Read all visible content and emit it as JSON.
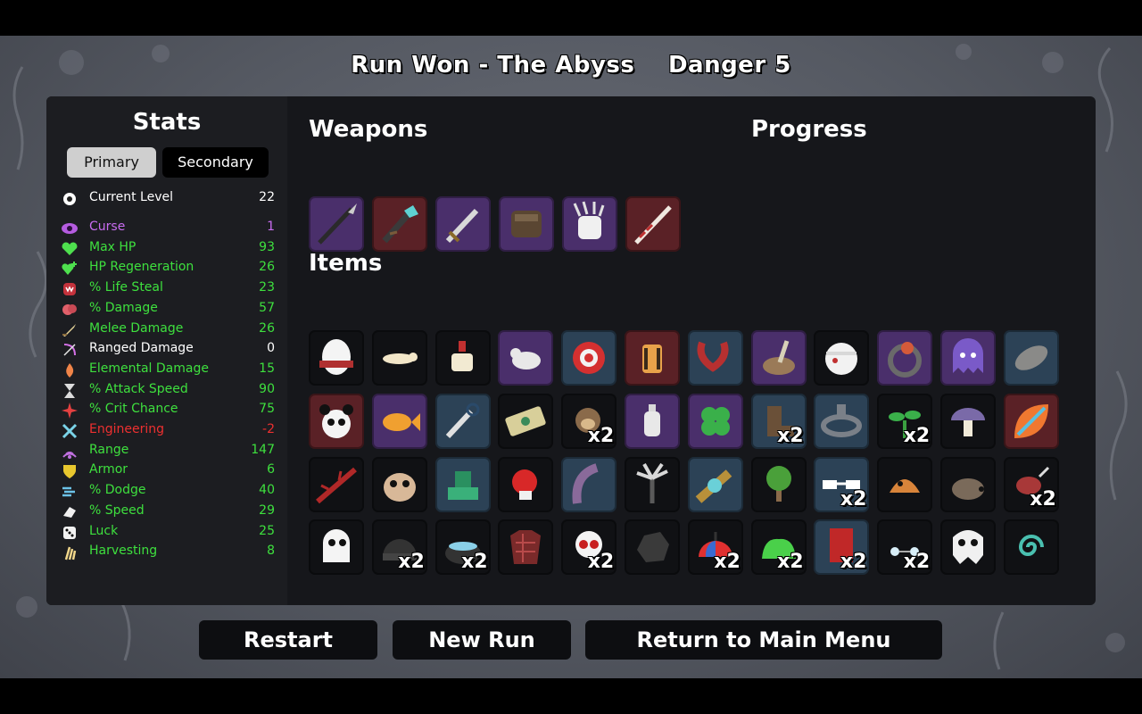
{
  "header": {
    "run_result": "Run Won - The Abyss",
    "danger": "Danger 5"
  },
  "stats": {
    "title": "Stats",
    "tabs": {
      "primary": "Primary",
      "secondary": "Secondary"
    },
    "rows": [
      {
        "icon": "level-icon",
        "label": "Current Level",
        "value": "22",
        "color": "#ffffff"
      },
      {
        "icon": "curse-icon",
        "label": "Curse",
        "value": "1",
        "color": "#c86cf0"
      },
      {
        "icon": "heart-icon",
        "label": "Max HP",
        "value": "93",
        "color": "#3ee03e"
      },
      {
        "icon": "hp-regen-icon",
        "label": "HP Regeneration",
        "value": "26",
        "color": "#3ee03e"
      },
      {
        "icon": "life-steal-icon",
        "label": "% Life Steal",
        "value": "23",
        "color": "#3ee03e"
      },
      {
        "icon": "damage-icon",
        "label": "% Damage",
        "value": "57",
        "color": "#3ee03e"
      },
      {
        "icon": "melee-icon",
        "label": "Melee Damage",
        "value": "26",
        "color": "#3ee03e"
      },
      {
        "icon": "ranged-icon",
        "label": "Ranged Damage",
        "value": "0",
        "color": "#ffffff"
      },
      {
        "icon": "elemental-icon",
        "label": "Elemental Damage",
        "value": "15",
        "color": "#3ee03e"
      },
      {
        "icon": "hourglass-icon",
        "label": "% Attack Speed",
        "value": "90",
        "color": "#3ee03e"
      },
      {
        "icon": "crit-icon",
        "label": "% Crit Chance",
        "value": "75",
        "color": "#3ee03e"
      },
      {
        "icon": "engineering-icon",
        "label": "Engineering",
        "value": "-2",
        "color": "#ee3030"
      },
      {
        "icon": "range-icon",
        "label": "Range",
        "value": "147",
        "color": "#3ee03e"
      },
      {
        "icon": "armor-icon",
        "label": "Armor",
        "value": "6",
        "color": "#3ee03e"
      },
      {
        "icon": "dodge-icon",
        "label": "% Dodge",
        "value": "40",
        "color": "#3ee03e"
      },
      {
        "icon": "speed-icon",
        "label": "% Speed",
        "value": "29",
        "color": "#3ee03e"
      },
      {
        "icon": "luck-icon",
        "label": "Luck",
        "value": "25",
        "color": "#3ee03e"
      },
      {
        "icon": "harvesting-icon",
        "label": "Harvesting",
        "value": "8",
        "color": "#3ee03e"
      }
    ]
  },
  "weapons": {
    "title": "Weapons",
    "slots": [
      {
        "icon": "spear-icon",
        "tier": 2
      },
      {
        "icon": "tentacle-blade-icon",
        "tier": 3
      },
      {
        "icon": "sword-icon",
        "tier": 2
      },
      {
        "icon": "power-fist-icon",
        "tier": 2
      },
      {
        "icon": "claw-glove-icon",
        "tier": 2
      },
      {
        "icon": "lance-icon",
        "tier": 3
      }
    ]
  },
  "progress": {
    "title": "Progress"
  },
  "items": {
    "title": "Items",
    "slots": [
      {
        "icon": "egg-icon",
        "tier": 0,
        "count": ""
      },
      {
        "icon": "ferret-icon",
        "tier": 0,
        "count": ""
      },
      {
        "icon": "coffee-cup-icon",
        "tier": 0,
        "count": ""
      },
      {
        "icon": "rat-icon",
        "tier": 2,
        "count": ""
      },
      {
        "icon": "target-ring-icon",
        "tier": 1,
        "count": ""
      },
      {
        "icon": "lantern-icon",
        "tier": 3,
        "count": ""
      },
      {
        "icon": "horn-creature-icon",
        "tier": 1,
        "count": ""
      },
      {
        "icon": "mortar-pestle-icon",
        "tier": 2,
        "count": ""
      },
      {
        "icon": "bandaged-head-icon",
        "tier": 0,
        "count": ""
      },
      {
        "icon": "eye-ring-icon",
        "tier": 2,
        "count": ""
      },
      {
        "icon": "ghost-blob-icon",
        "tier": 2,
        "count": ""
      },
      {
        "icon": "cocoon-icon",
        "tier": 1,
        "count": ""
      },
      {
        "icon": "panda-icon",
        "tier": 3,
        "count": ""
      },
      {
        "icon": "goldfish-icon",
        "tier": 2,
        "count": ""
      },
      {
        "icon": "grapple-icon",
        "tier": 1,
        "count": ""
      },
      {
        "icon": "banknote-icon",
        "tier": 0,
        "count": ""
      },
      {
        "icon": "monkey-icon",
        "tier": 0,
        "count": "x2"
      },
      {
        "icon": "bottle-icon",
        "tier": 2,
        "count": ""
      },
      {
        "icon": "clover-icon",
        "tier": 2,
        "count": ""
      },
      {
        "icon": "boot-icon",
        "tier": 1,
        "count": "x2"
      },
      {
        "icon": "stone-circle-icon",
        "tier": 1,
        "count": ""
      },
      {
        "icon": "sprout-icon",
        "tier": 0,
        "count": "x2"
      },
      {
        "icon": "mushroom-icon",
        "tier": 0,
        "count": ""
      },
      {
        "icon": "rainbow-leaf-icon",
        "tier": 3,
        "count": ""
      },
      {
        "icon": "thorns-icon",
        "tier": 0,
        "count": ""
      },
      {
        "icon": "scared-sack-icon",
        "tier": 0,
        "count": ""
      },
      {
        "icon": "turret-icon",
        "tier": 1,
        "count": ""
      },
      {
        "icon": "boxing-glove-icon",
        "tier": 0,
        "count": ""
      },
      {
        "icon": "tentacle-icon",
        "tier": 1,
        "count": ""
      },
      {
        "icon": "palm-icon",
        "tier": 0,
        "count": ""
      },
      {
        "icon": "spyglass-icon",
        "tier": 1,
        "count": ""
      },
      {
        "icon": "tree-icon",
        "tier": 0,
        "count": ""
      },
      {
        "icon": "glasses-icon",
        "tier": 1,
        "count": "x2"
      },
      {
        "icon": "fox-icon",
        "tier": 0,
        "count": ""
      },
      {
        "icon": "hedgehog-icon",
        "tier": 0,
        "count": ""
      },
      {
        "icon": "robot-bug-icon",
        "tier": 0,
        "count": "x2"
      },
      {
        "icon": "ghost-icon",
        "tier": 0,
        "count": ""
      },
      {
        "icon": "beanie-icon",
        "tier": 0,
        "count": "x2"
      },
      {
        "icon": "cauldron-icon",
        "tier": 0,
        "count": "x2"
      },
      {
        "icon": "plaid-shirt-icon",
        "tier": 0,
        "count": ""
      },
      {
        "icon": "skull-icon",
        "tier": 0,
        "count": "x2"
      },
      {
        "icon": "coal-icon",
        "tier": 0,
        "count": ""
      },
      {
        "icon": "propeller-cap-icon",
        "tier": 0,
        "count": "x2"
      },
      {
        "icon": "slime-icon",
        "tier": 0,
        "count": "x2"
      },
      {
        "icon": "banner-icon",
        "tier": 1,
        "count": "x2"
      },
      {
        "icon": "pearls-icon",
        "tier": 0,
        "count": "x2"
      },
      {
        "icon": "fang-skull-icon",
        "tier": 0,
        "count": ""
      },
      {
        "icon": "swirl-icon",
        "tier": 0,
        "count": ""
      }
    ]
  },
  "buttons": {
    "restart": "Restart",
    "new_run": "New Run",
    "main_menu": "Return to Main Menu"
  }
}
